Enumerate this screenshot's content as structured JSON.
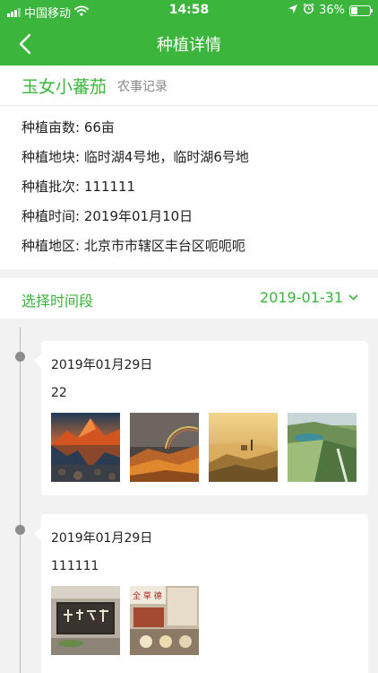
{
  "status_bar": {
    "carrier": "中国移动",
    "time": "14:58",
    "battery": "36%",
    "battery_level": 0.36
  },
  "nav": {
    "title": "种植详情",
    "back_icon": "chevron-left-icon"
  },
  "crop": {
    "name": "玉女小蕃茄",
    "records_link": "农事记录"
  },
  "info_rows": [
    "种植亩数: 66亩",
    "种植地块: 临时湖4号地，临时湖6号地",
    "种植批次: 111111",
    "种植时间: 2019年01月10日",
    "种植地区: 北京市市辖区丰台区呃呃呃"
  ],
  "date_filter": {
    "label": "选择时间段",
    "value": "2019-01-31"
  },
  "records": [
    {
      "date": "2019年01月29日",
      "text": "22",
      "photos": [
        "mountain-lake-photo",
        "rainbow-desert-photo",
        "misty-hills-photo",
        "green-valley-photo"
      ]
    },
    {
      "date": "2019年01月29日",
      "text": "111111",
      "photos": [
        "calligraphy-sign-photo",
        "office-shelf-photo"
      ]
    }
  ],
  "colors": {
    "brand_green": "#3bb53b",
    "background": "#f2f2f2"
  }
}
